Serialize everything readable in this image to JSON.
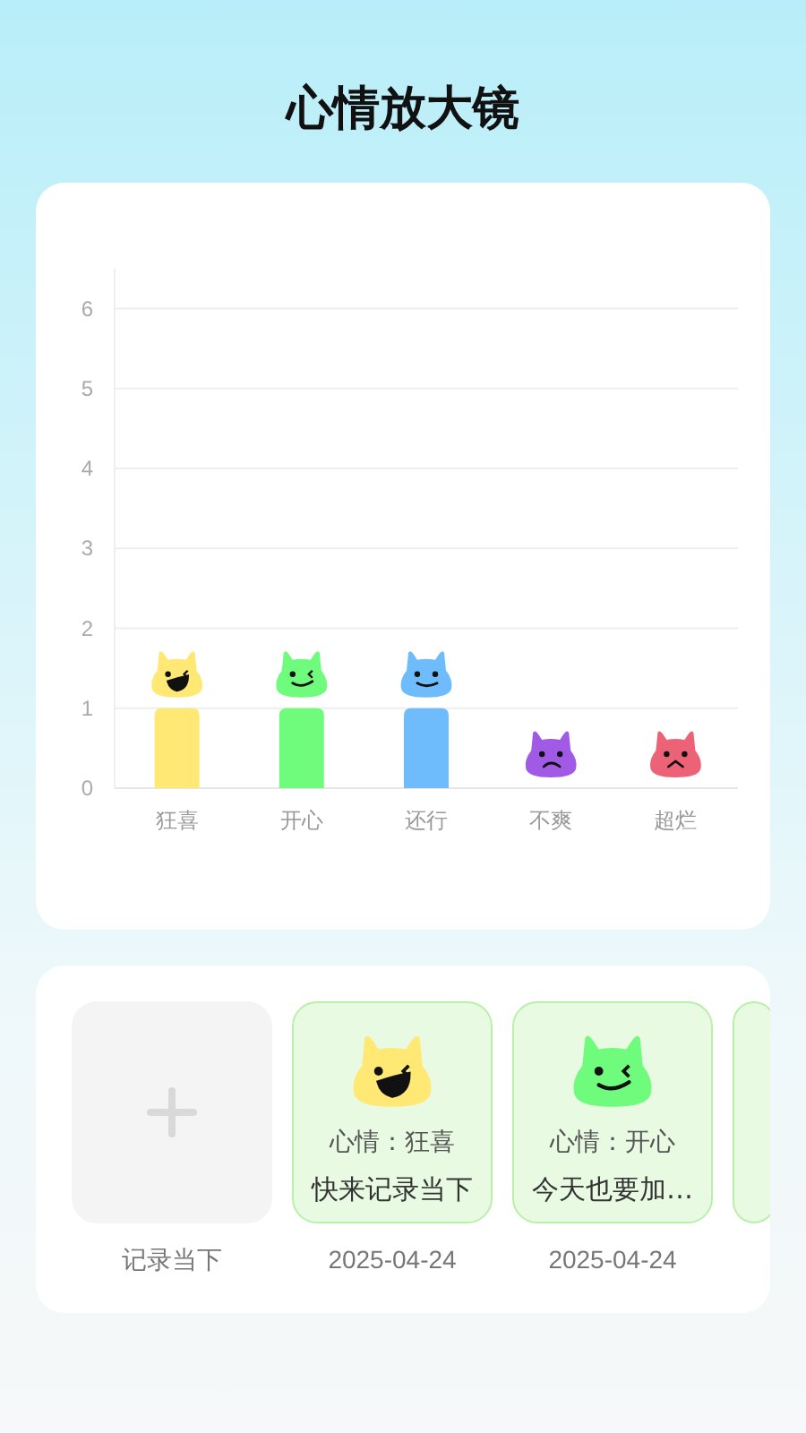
{
  "title": "心情放大镜",
  "chart_data": {
    "type": "bar",
    "categories": [
      "狂喜",
      "开心",
      "还行",
      "不爽",
      "超烂"
    ],
    "values": [
      1,
      1,
      1,
      0,
      0
    ],
    "yticks": [
      0,
      1,
      2,
      3,
      4,
      5,
      6
    ],
    "ylim": [
      0,
      6.5
    ],
    "grid": true
  },
  "moods": [
    {
      "color": "#ffe873",
      "kind": "grin"
    },
    {
      "color": "#6ffb7c",
      "kind": "wink"
    },
    {
      "color": "#6ebcfb",
      "kind": "smile"
    },
    {
      "color": "#a05ae6",
      "kind": "frown"
    },
    {
      "color": "#ec6277",
      "kind": "upset"
    }
  ],
  "add": {
    "label": "记录当下"
  },
  "entries": [
    {
      "peek": false,
      "color": "#ffe873",
      "kind": "grin",
      "mood": "心情：狂喜",
      "note": "快来记录当下",
      "date": "2025-04-24"
    },
    {
      "peek": false,
      "color": "#6ffb7c",
      "kind": "wink",
      "mood": "心情：开心",
      "note": "今天也要加…",
      "date": "2025-04-24"
    },
    {
      "peek": true
    }
  ]
}
